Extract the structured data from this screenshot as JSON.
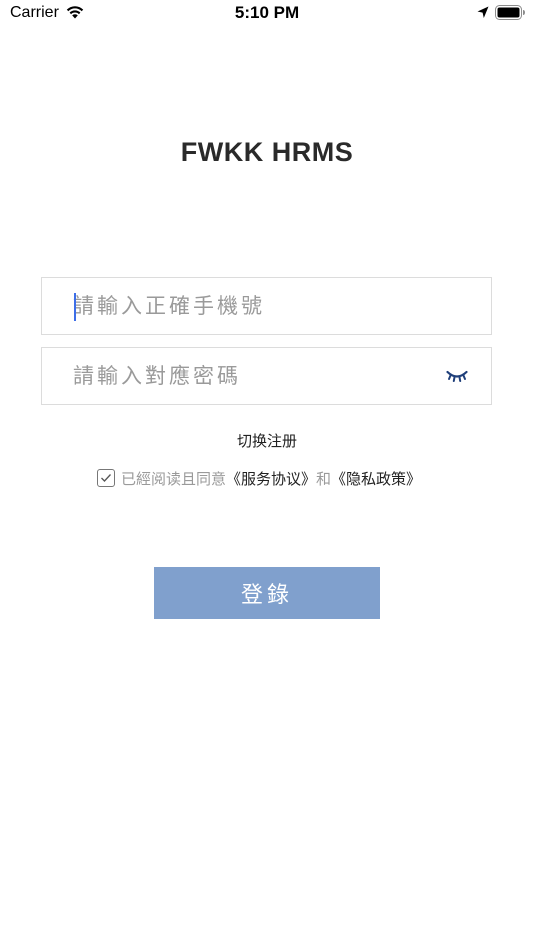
{
  "status_bar": {
    "carrier": "Carrier",
    "time": "5:10 PM",
    "icons": [
      "wifi-icon",
      "location-icon",
      "battery-icon"
    ]
  },
  "app": {
    "title": "FWKK HRMS"
  },
  "form": {
    "phone_placeholder": "請輸入正確手機號",
    "phone_value": "",
    "password_placeholder": "請輸入對應密碼",
    "password_value": "",
    "password_toggle_icon": "eye-closed-icon",
    "switch_register": "切换注册",
    "agreement": {
      "checked": true,
      "prefix": "已經阅读且同意",
      "service_link": "《服务协议》",
      "conjunction": "和",
      "privacy_link": "《隐私政策》"
    },
    "login_label": "登錄"
  },
  "colors": {
    "login_button": "#80a0cd",
    "caret": "#3d6ee8",
    "eye_icon": "#1f3f7a",
    "placeholder": "#9a9a9a"
  }
}
